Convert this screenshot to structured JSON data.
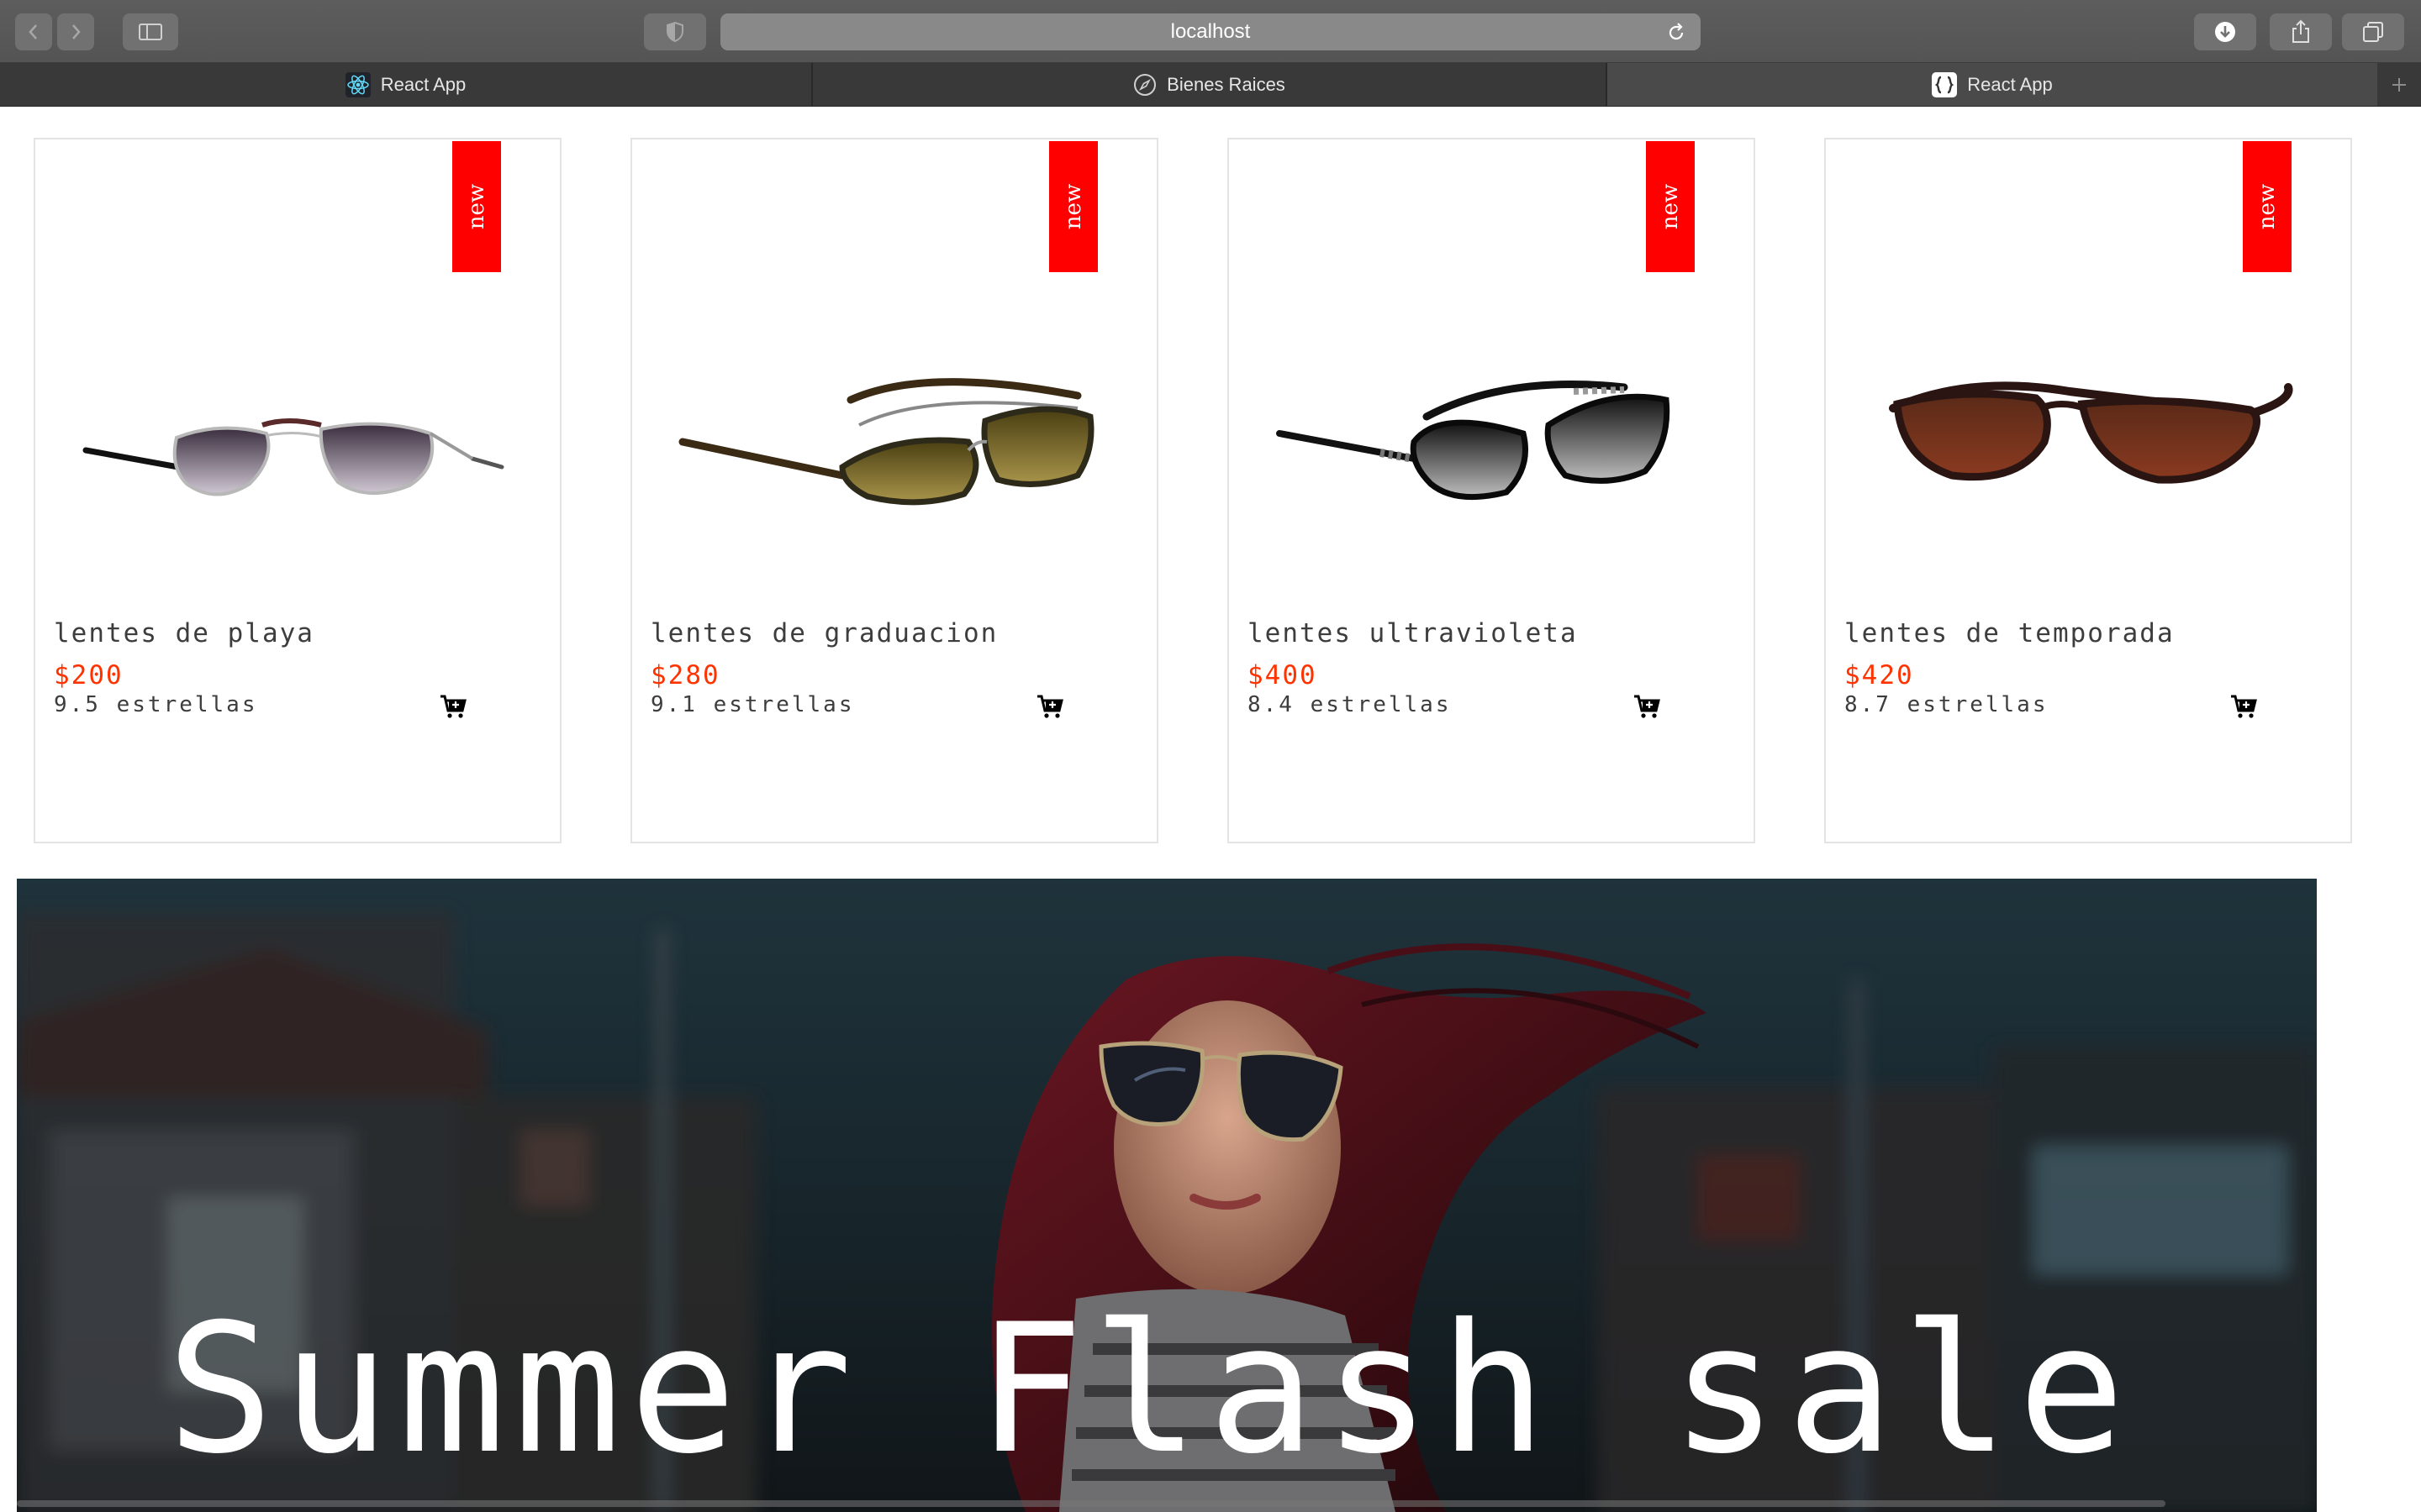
{
  "browser": {
    "address": "localhost",
    "tabs": [
      {
        "label": "React App",
        "icon": "react-icon"
      },
      {
        "label": "Bienes Raices",
        "icon": "compass-icon"
      },
      {
        "label": "React App",
        "icon": "brackets-icon"
      }
    ]
  },
  "products": [
    {
      "badge": "new",
      "name": "lentes de playa",
      "price": "$200",
      "rating": "9.5 estrellas"
    },
    {
      "badge": "new",
      "name": "lentes de graduacion",
      "price": "$280",
      "rating": "9.1 estrellas"
    },
    {
      "badge": "new",
      "name": "lentes ultravioleta",
      "price": "$400",
      "rating": "8.4 estrellas"
    },
    {
      "badge": "new",
      "name": "lentes de temporada",
      "price": "$420",
      "rating": "8.7 estrellas"
    }
  ],
  "banner": {
    "title": "Summer Flash sale"
  },
  "colors": {
    "badge": "#ff0000",
    "price": "#ff3300",
    "toolbar": "#5a595a",
    "tabbar": "#3a393a"
  }
}
